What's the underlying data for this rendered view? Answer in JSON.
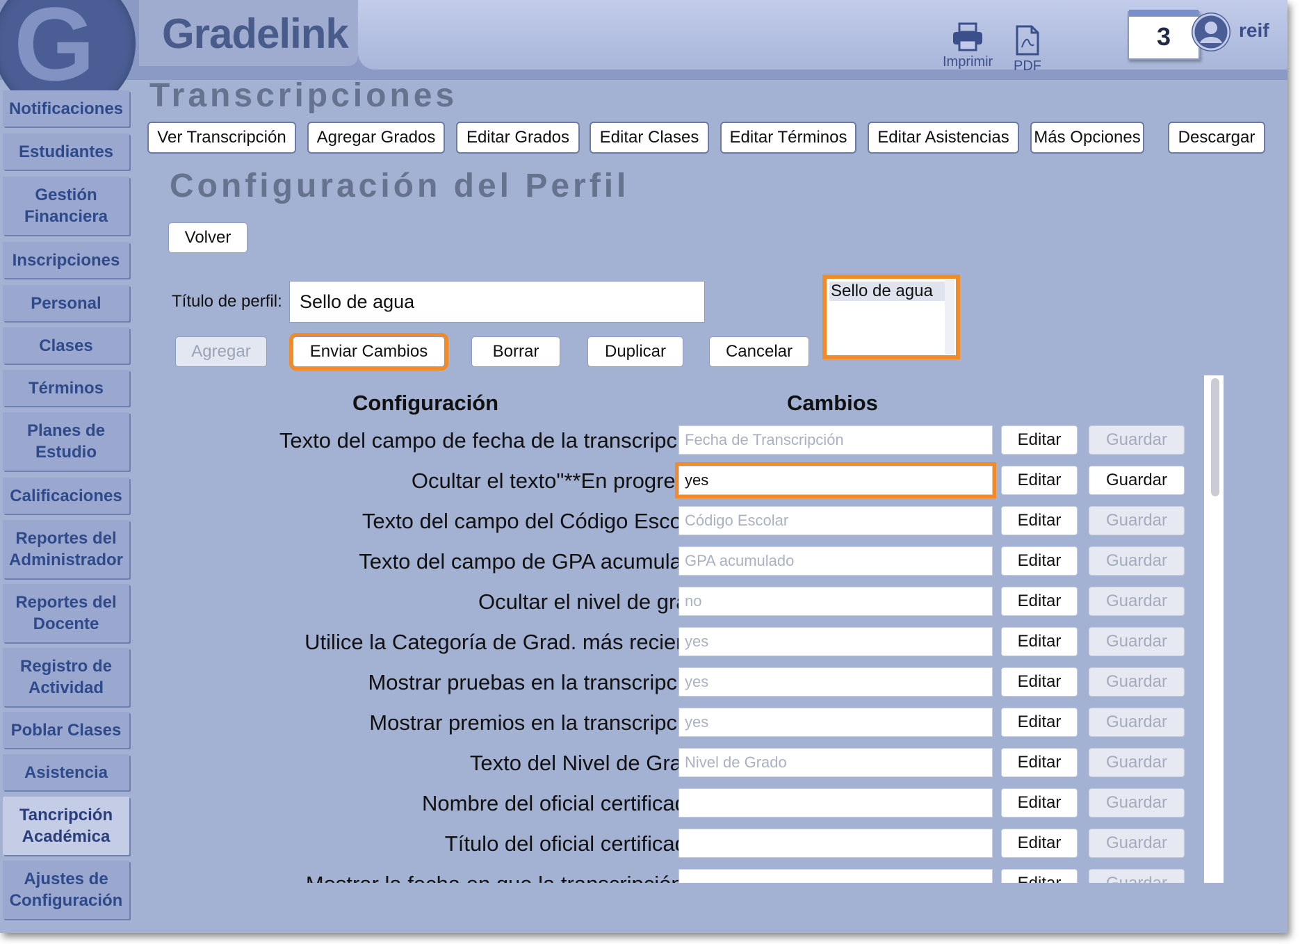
{
  "app": {
    "brand": "Gradelink",
    "logo_letter": "G"
  },
  "toolbar": {
    "print_label": "Imprimir",
    "pdf_label": "PDF"
  },
  "calendar": {
    "day": "3"
  },
  "user": {
    "name": "reif"
  },
  "sidebar": {
    "items": [
      {
        "label": "Notificaciones"
      },
      {
        "label": "Estudiantes"
      },
      {
        "label": "Gestión Financiera"
      },
      {
        "label": "Inscripciones"
      },
      {
        "label": "Personal"
      },
      {
        "label": "Clases"
      },
      {
        "label": "Términos"
      },
      {
        "label": "Planes de Estudio"
      },
      {
        "label": "Calificaciones"
      },
      {
        "label": "Reportes del Administrador"
      },
      {
        "label": "Reportes del Docente"
      },
      {
        "label": "Registro de Actividad"
      },
      {
        "label": "Poblar Clases"
      },
      {
        "label": "Asistencia"
      },
      {
        "label": "Tancripción Académica",
        "active": true
      },
      {
        "label": "Ajustes de Configuración"
      }
    ]
  },
  "page": {
    "title": "Transcripciones"
  },
  "tabs": [
    {
      "label": "Ver Transcripción"
    },
    {
      "label": "Agregar Grados"
    },
    {
      "label": "Editar Grados"
    },
    {
      "label": "Editar Clases"
    },
    {
      "label": "Editar Términos"
    },
    {
      "label": "Editar Asistencias"
    },
    {
      "label": "Más Opciones"
    },
    {
      "label": "Descargar"
    }
  ],
  "section": {
    "title": "Configuración del Perfil"
  },
  "actions": {
    "back": "Volver",
    "add": "Agregar",
    "send_changes": "Enviar Cambios",
    "delete": "Borrar",
    "duplicate": "Duplicar",
    "cancel": "Cancelar"
  },
  "profile": {
    "title_label": "Título de perfil:",
    "title_value": "Sello de agua",
    "list_options": [
      "Sello de agua"
    ]
  },
  "settings": {
    "column_config": "Configuración",
    "column_changes": "Cambios",
    "edit_label": "Editar",
    "save_label": "Guardar",
    "rows": [
      {
        "label": "Texto del campo de fecha de la transcripción:",
        "value": "Fecha de Transcripción"
      },
      {
        "label": "Ocultar el texto\"**En progreso\":",
        "value": "yes",
        "editing": true
      },
      {
        "label": "Texto del campo del Código Escolar:",
        "value": "Código Escolar"
      },
      {
        "label": "Texto del campo de GPA acumulado:",
        "value": "GPA acumulado"
      },
      {
        "label": "Ocultar el nivel de grado",
        "value": "no"
      },
      {
        "label": "Utilice la Categoría de Grad. más reciente:",
        "value": "yes"
      },
      {
        "label": "Mostrar pruebas en la transcripción:",
        "value": "yes"
      },
      {
        "label": "Mostrar premios en la transcripción:",
        "value": "yes"
      },
      {
        "label": "Texto del Nivel de Grado:",
        "value": "Nivel de Grado"
      },
      {
        "label": "Nombre del oficial certificador:",
        "value": ""
      },
      {
        "label": "Título del oficial certificador:",
        "value": ""
      },
      {
        "label": "Mostrar la fecha en que la transcripción se",
        "value": ""
      }
    ]
  },
  "colors": {
    "accent": "#f08b27",
    "background": "#a3b1d3",
    "nav_text": "#2f4a8a"
  }
}
